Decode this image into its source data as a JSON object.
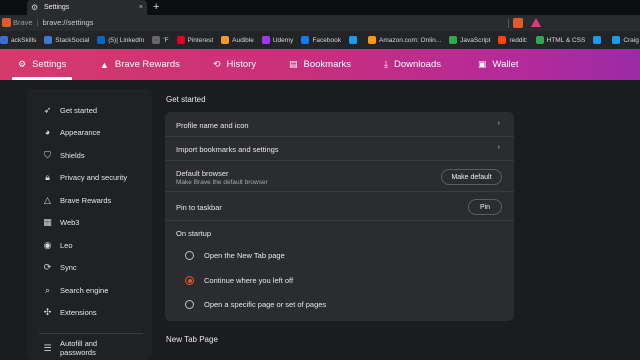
{
  "browser": {
    "tab": {
      "title": "Settings",
      "close": "×"
    },
    "new_tab": "+",
    "address": {
      "site": "Brave",
      "url": "brave://settings"
    },
    "bookmarks": [
      {
        "label": "ackSkills",
        "color": "#3a6fd1"
      },
      {
        "label": "StackSocial",
        "color": "#3a7bd5"
      },
      {
        "label": "(5)| LinkedIn",
        "color": "#0a66c2"
      },
      {
        "label": "'F",
        "color": "#666666"
      },
      {
        "label": "Pinterest",
        "color": "#e60023"
      },
      {
        "label": "Audible",
        "color": "#f29a1f"
      },
      {
        "label": "Udemy",
        "color": "#a435f0"
      },
      {
        "label": "Facebook",
        "color": "#1877f2"
      },
      {
        "label": "",
        "color": "#1d9bf0"
      },
      {
        "label": "Amazon.com: Onlin...",
        "color": "#ff9900"
      },
      {
        "label": "JavaScript",
        "color": "#2fa84f"
      },
      {
        "label": "reddit:",
        "color": "#ff4500"
      },
      {
        "label": "HTML & CSS",
        "color": "#2fa84f"
      },
      {
        "label": "",
        "color": "#1d9bf0"
      },
      {
        "label": "Craig Johnson (@Cr...",
        "color": "#1d9bf0"
      }
    ]
  },
  "nav": {
    "items": [
      {
        "label": "Settings",
        "icon": "gear-icon",
        "glyph": "⚙"
      },
      {
        "label": "Brave Rewards",
        "icon": "triangle-icon",
        "glyph": "▲"
      },
      {
        "label": "History",
        "icon": "history-icon",
        "glyph": "⟲"
      },
      {
        "label": "Bookmarks",
        "icon": "bookmarks-icon",
        "glyph": "▤"
      },
      {
        "label": "Downloads",
        "icon": "download-icon",
        "glyph": "⤓"
      },
      {
        "label": "Wallet",
        "icon": "wallet-icon",
        "glyph": "▣"
      }
    ]
  },
  "sidebar": {
    "items": [
      {
        "label": "Get started",
        "icon": "rocket-icon",
        "glyph": "➶"
      },
      {
        "label": "Appearance",
        "icon": "palette-icon",
        "glyph": "◕"
      },
      {
        "label": "Shields",
        "icon": "shield-icon",
        "glyph": "⛉"
      },
      {
        "label": "Privacy and security",
        "icon": "lock-icon",
        "glyph": "🔒︎"
      },
      {
        "label": "Brave Rewards",
        "icon": "rewards-icon",
        "glyph": "△"
      },
      {
        "label": "Web3",
        "icon": "web3-icon",
        "glyph": "▦"
      },
      {
        "label": "Leo",
        "icon": "leo-icon",
        "glyph": "◉"
      },
      {
        "label": "Sync",
        "icon": "sync-icon",
        "glyph": "⟳"
      },
      {
        "label": "Search engine",
        "icon": "search-icon",
        "glyph": "⌕"
      },
      {
        "label": "Extensions",
        "icon": "puzzle-icon",
        "glyph": "✣"
      },
      {
        "label": "Autofill and passwords",
        "icon": "list-icon",
        "glyph": "☰"
      }
    ]
  },
  "main": {
    "section_title": "Get started",
    "rows": {
      "profile": "Profile name and icon",
      "import": "Import bookmarks and settings",
      "default_browser": "Default browser",
      "default_browser_sub": "Make Brave the default browser",
      "make_default_btn": "Make default",
      "pin_taskbar": "Pin to taskbar",
      "pin_btn": "Pin",
      "on_startup": "On startup",
      "chevron": "›"
    },
    "startup_options": [
      {
        "label": "Open the New Tab page",
        "checked": false
      },
      {
        "label": "Continue where you left off",
        "checked": true
      },
      {
        "label": "Open a specific page or set of pages",
        "checked": false
      }
    ],
    "next_section_title": "New Tab Page"
  },
  "colors": {
    "accent": "#e8522d",
    "nav_gradient_start": "#d53a6c",
    "nav_gradient_end": "#9c2aa6"
  }
}
